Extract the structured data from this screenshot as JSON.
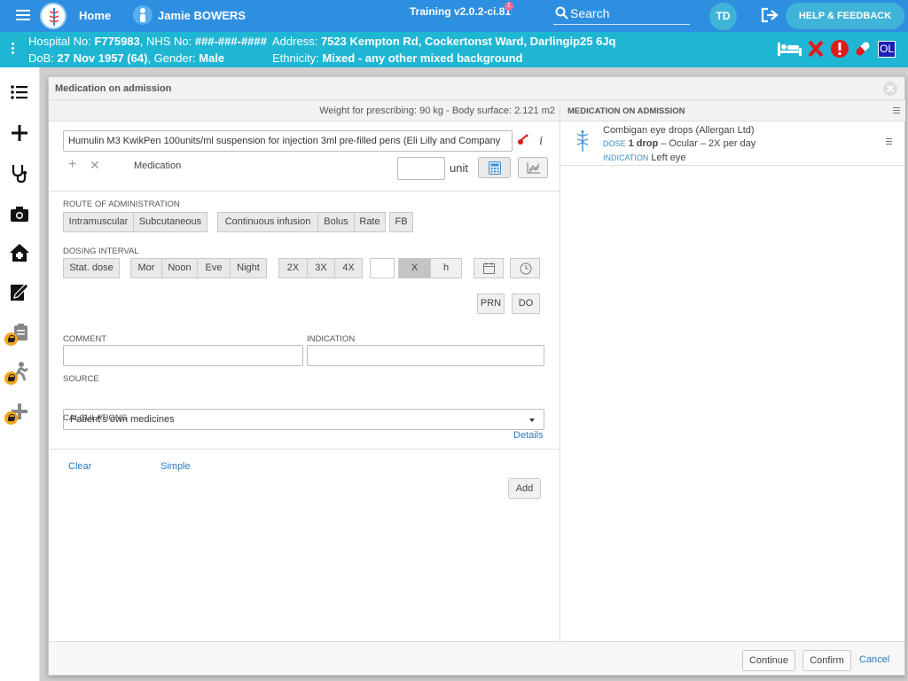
{
  "header": {
    "home_label": "Home",
    "patient_name": "Jamie BOWERS",
    "version": "Training v2.0.2-ci.81",
    "version_badge": "1",
    "search_label": "Search",
    "user_initials": "TD",
    "help_label": "HELP & FEEDBACK"
  },
  "banner": {
    "hospital_label": "Hospital No:",
    "hospital_no": "F775983",
    "nhs_label": ", NHS No:",
    "nhs_no": "###-###-####",
    "address_label": "Address:",
    "address": "7523 Kempton Rd, Cockertonst Ward, Darlingip25 6Jq",
    "dob_label": "DoB:",
    "dob": "27 Nov 1957 (64)",
    "gender_label": ", Gender:",
    "gender": "Male",
    "ethnicity_label": "Ethnicity:",
    "ethnicity": "Mixed - any other mixed background",
    "ol_badge": "OL"
  },
  "modal": {
    "title": "Medication on admission",
    "weight_text": "Weight for prescribing: 90 kg - Body surface: 2.121 m2",
    "medication_value": "Humulin M3 KwikPen 100units/ml suspension for injection 3ml pre-filled pens (Eli Lilly and Company",
    "medication_label": "Medication",
    "unit_label": "unit",
    "route_label": "ROUTE OF ADMINISTRATION",
    "routes": [
      "Intramuscular",
      "Subcutaneous",
      "Continuous infusion",
      "Bolus",
      "Rate",
      "FB"
    ],
    "dosing_label": "DOSING INTERVAL",
    "stat_dose": "Stat. dose",
    "times": [
      "Mor",
      "Noon",
      "Eve",
      "Night"
    ],
    "freq": [
      "2X",
      "3X",
      "4X"
    ],
    "x_label": "X",
    "h_label": "h",
    "prn": "PRN",
    "do": "DO",
    "comment_label": "COMMENT",
    "indication_label": "INDICATION",
    "source_label": "SOURCE",
    "source_value": "Patient's own medicines",
    "calculations_label": "CALCULATIONS",
    "details_link": "Details",
    "clear_link": "Clear",
    "simple_link": "Simple",
    "add_button": "Add"
  },
  "right_pane": {
    "title": "MEDICATION ON ADMISSION",
    "items": [
      {
        "name": "Combigan eye drops (Allergan Ltd)",
        "dose_label": "DOSE",
        "dose_amount": "1 drop",
        "dose_rest": " – Ocular – 2X per day",
        "indication_label": "INDICATION",
        "indication": "Left eye"
      }
    ]
  },
  "footer": {
    "continue": "Continue",
    "confirm": "Confirm",
    "cancel": "Cancel"
  },
  "colors": {
    "topbar": "#2e8fe0",
    "banner": "#1fb6d4",
    "accent_button": "#3fb4d8",
    "alert_red": "#e01a1a",
    "link_blue": "#2a7bbd"
  }
}
